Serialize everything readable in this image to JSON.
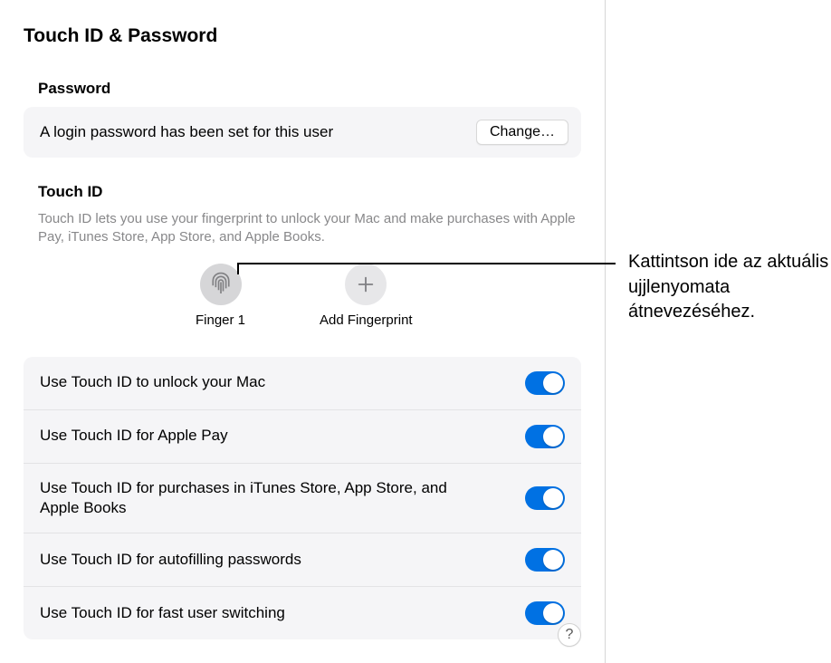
{
  "page_title": "Touch ID & Password",
  "password": {
    "section_title": "Password",
    "status_text": "A login password has been set for this user",
    "change_label": "Change…"
  },
  "touchid": {
    "section_title": "Touch ID",
    "description": "Touch ID lets you use your fingerprint to unlock your Mac and make purchases with Apple Pay, iTunes Store, App Store, and Apple Books.",
    "finger_label": "Finger 1",
    "add_label": "Add Fingerprint"
  },
  "toggles": [
    {
      "label": "Use Touch ID to unlock your Mac",
      "enabled": true
    },
    {
      "label": "Use Touch ID for Apple Pay",
      "enabled": true
    },
    {
      "label": "Use Touch ID for purchases in iTunes Store, App Store, and Apple Books",
      "enabled": true
    },
    {
      "label": "Use Touch ID for autofilling passwords",
      "enabled": true
    },
    {
      "label": "Use Touch ID for fast user switching",
      "enabled": true
    }
  ],
  "help_label": "?",
  "callout_text": "Kattintson ide az aktuális ujjlenyomata átnevezéséhez."
}
